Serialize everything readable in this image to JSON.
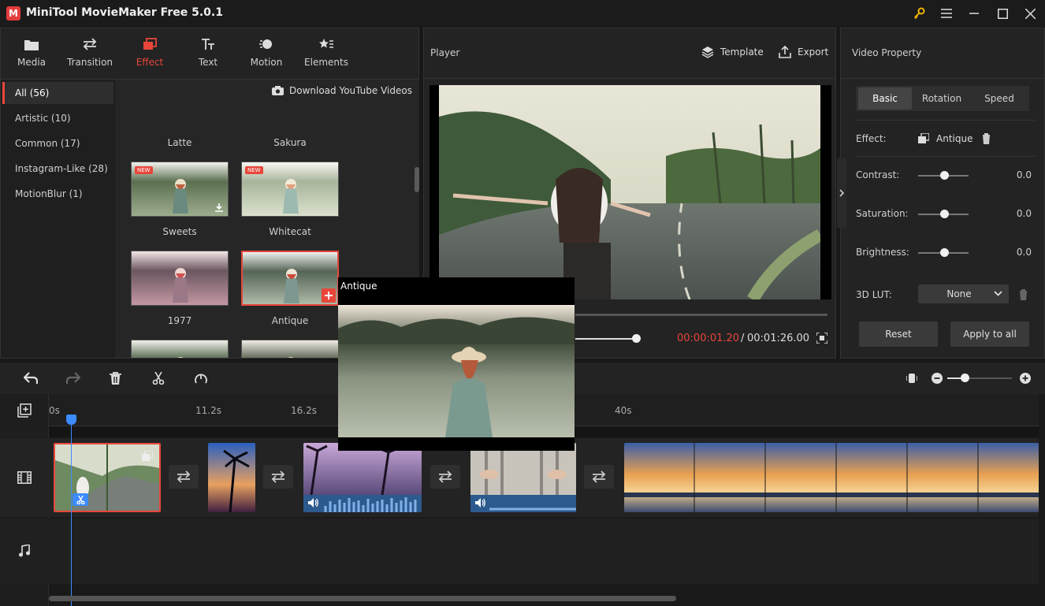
{
  "app": {
    "title": "MiniTool MovieMaker Free 5.0.1",
    "logo_letter": "M"
  },
  "tabs": [
    {
      "label": "Media",
      "icon": "folder-icon"
    },
    {
      "label": "Transition",
      "icon": "transition-arrows-icon"
    },
    {
      "label": "Effect",
      "icon": "effect-layers-icon",
      "active": true
    },
    {
      "label": "Text",
      "icon": "text-icon"
    },
    {
      "label": "Motion",
      "icon": "motion-icon"
    },
    {
      "label": "Elements",
      "icon": "elements-icon"
    }
  ],
  "categories": [
    {
      "label": "All (56)",
      "active": true
    },
    {
      "label": "Artistic (10)"
    },
    {
      "label": "Common (17)"
    },
    {
      "label": "Instagram-Like (28)"
    },
    {
      "label": "MotionBlur (1)"
    }
  ],
  "download_youtube": "Download YouTube Videos",
  "effects": {
    "row0": [
      "Latte",
      "Sakura"
    ],
    "row1": [
      "Sweets",
      "Whitecat"
    ],
    "row2": [
      "1977",
      "Antique"
    ],
    "new_badge": "NEW"
  },
  "player": {
    "title": "Player",
    "template_label": "Template",
    "export_label": "Export",
    "current_time": "00:00:01.20",
    "separator": "/",
    "total_time": "00:01:26.00"
  },
  "property": {
    "title": "Video Property",
    "tabs": [
      "Basic",
      "Rotation",
      "Speed"
    ],
    "effect_label": "Effect:",
    "effect_value": "Antique",
    "contrast_label": "Contrast:",
    "contrast_value": "0.0",
    "saturation_label": "Saturation:",
    "saturation_value": "0.0",
    "brightness_label": "Brightness:",
    "brightness_value": "0.0",
    "lut_label": "3D LUT:",
    "lut_value": "None",
    "reset_label": "Reset",
    "apply_label": "Apply to all"
  },
  "timeline": {
    "ruler": [
      "0s",
      "11.2s",
      "16.2s",
      "40s"
    ]
  },
  "popup": {
    "title": "Antique"
  },
  "colors": {
    "accent": "#e8463b",
    "playhead": "#3b8bff"
  }
}
